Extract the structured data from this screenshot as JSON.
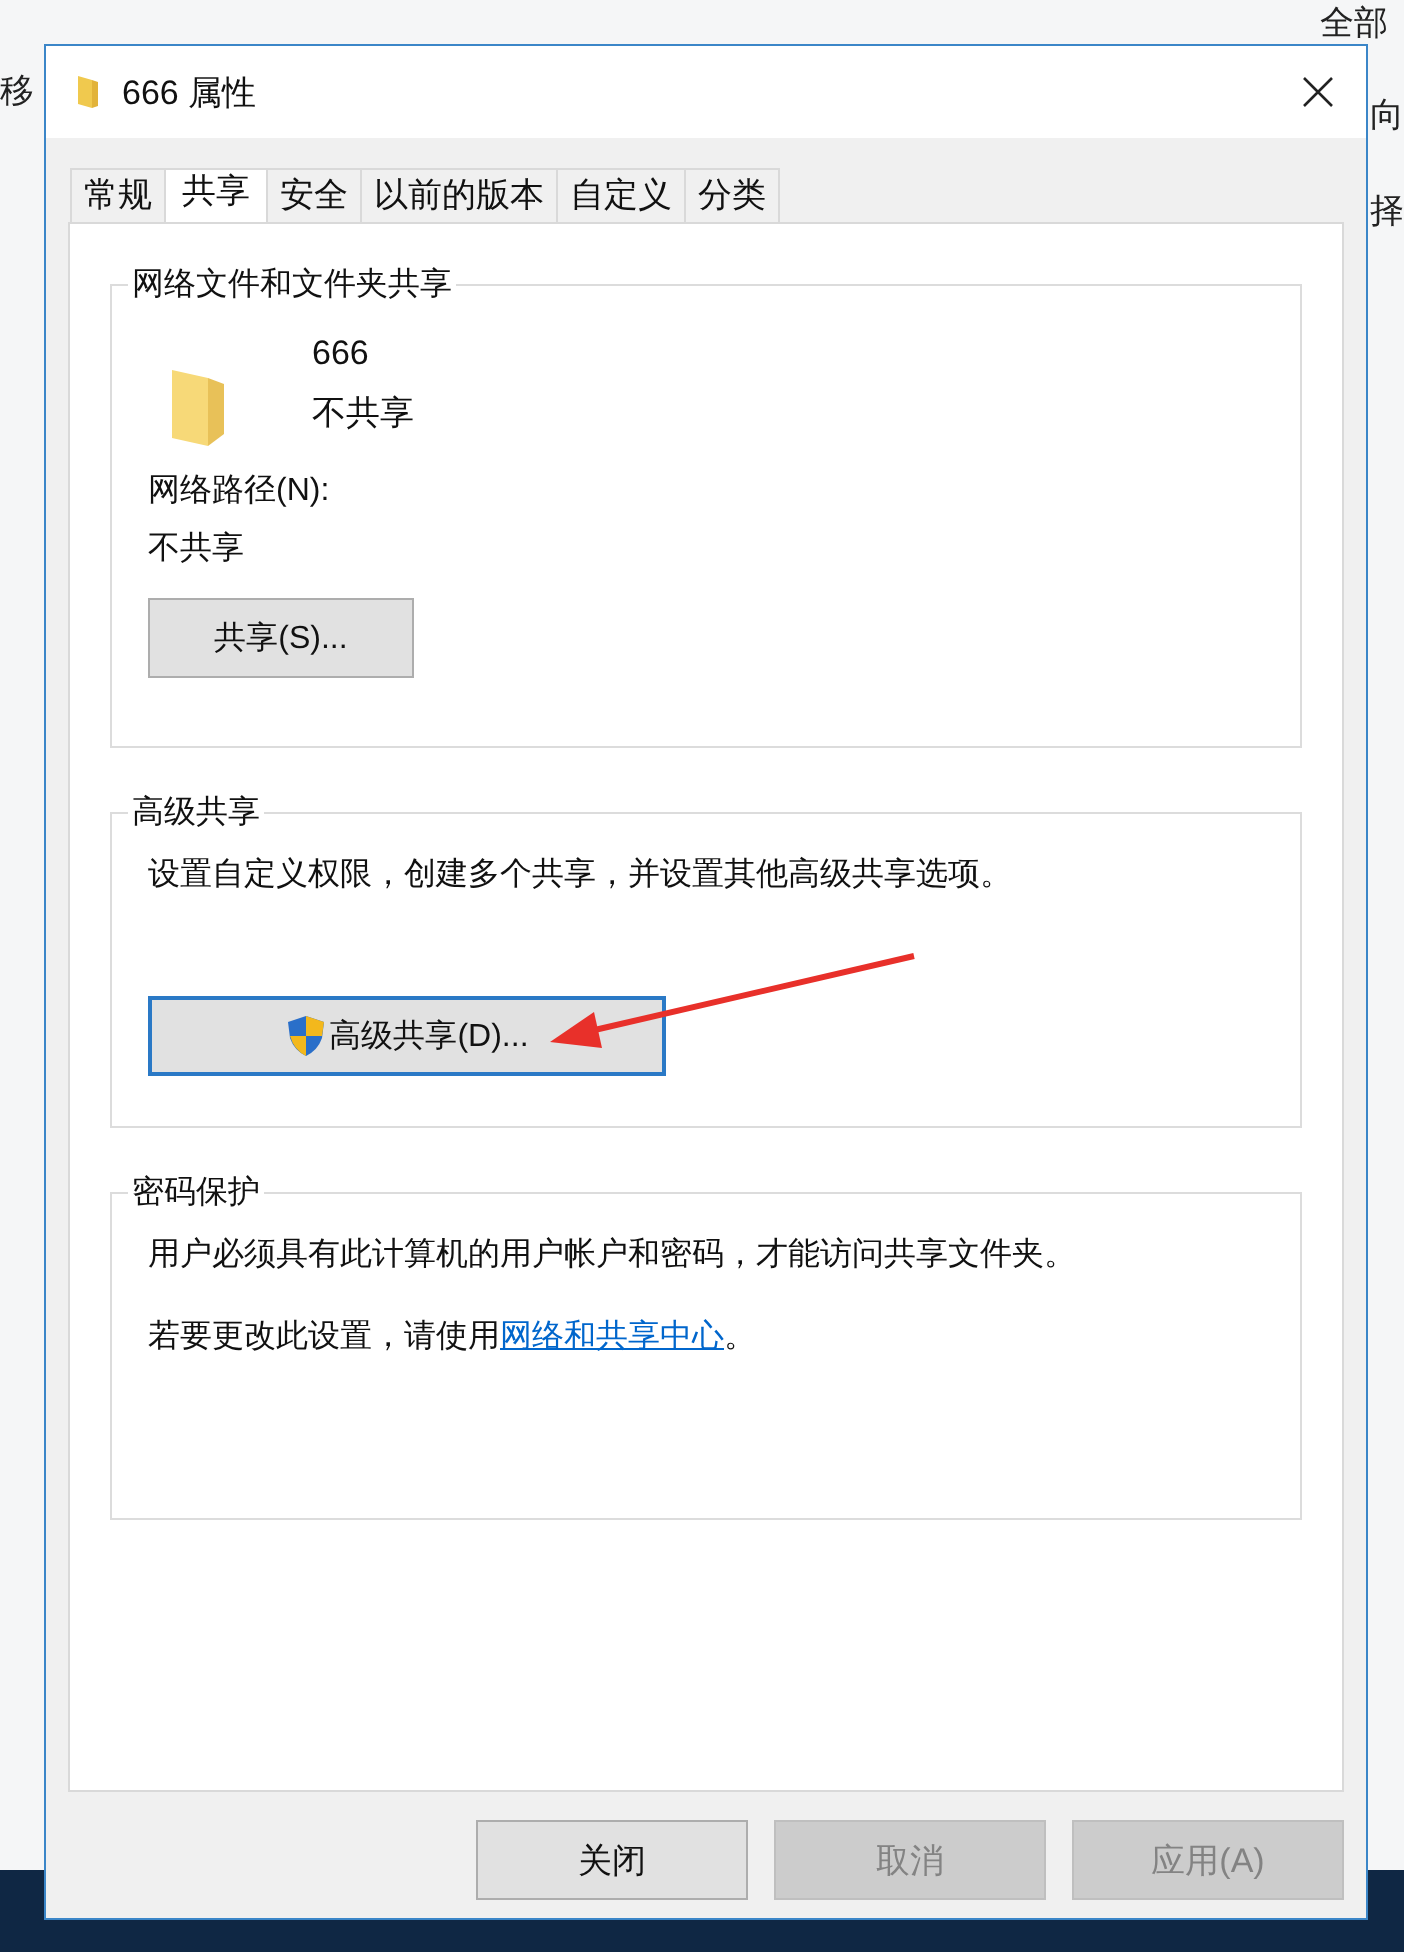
{
  "explorer_fragments": [
    "移",
    "全部",
    "向",
    "择"
  ],
  "window": {
    "title": "666 属性"
  },
  "tabs": [
    {
      "label": "常规",
      "selected": false
    },
    {
      "label": "共享",
      "selected": true
    },
    {
      "label": "安全",
      "selected": false
    },
    {
      "label": "以前的版本",
      "selected": false
    },
    {
      "label": "自定义",
      "selected": false
    },
    {
      "label": "分类",
      "selected": false
    }
  ],
  "network_sharing": {
    "title": "网络文件和文件夹共享",
    "folder_name": "666",
    "status": "不共享",
    "path_label": "网络路径(N):",
    "path_value": "不共享",
    "button": "共享(S)..."
  },
  "advanced_sharing": {
    "title": "高级共享",
    "description": "设置自定义权限，创建多个共享，并设置其他高级共享选项。",
    "button": "高级共享(D)...",
    "button_focused": true
  },
  "password_protection": {
    "title": "密码保护",
    "text": "用户必须具有此计算机的用户帐户和密码，才能访问共享文件夹。",
    "change_prefix": "若要更改此设置，请使用",
    "link": "网络和共享中心",
    "change_suffix": "。"
  },
  "buttons": [
    {
      "label": "关闭",
      "disabled": false
    },
    {
      "label": "取消",
      "disabled": true
    },
    {
      "label": "应用(A)",
      "disabled": true
    }
  ]
}
